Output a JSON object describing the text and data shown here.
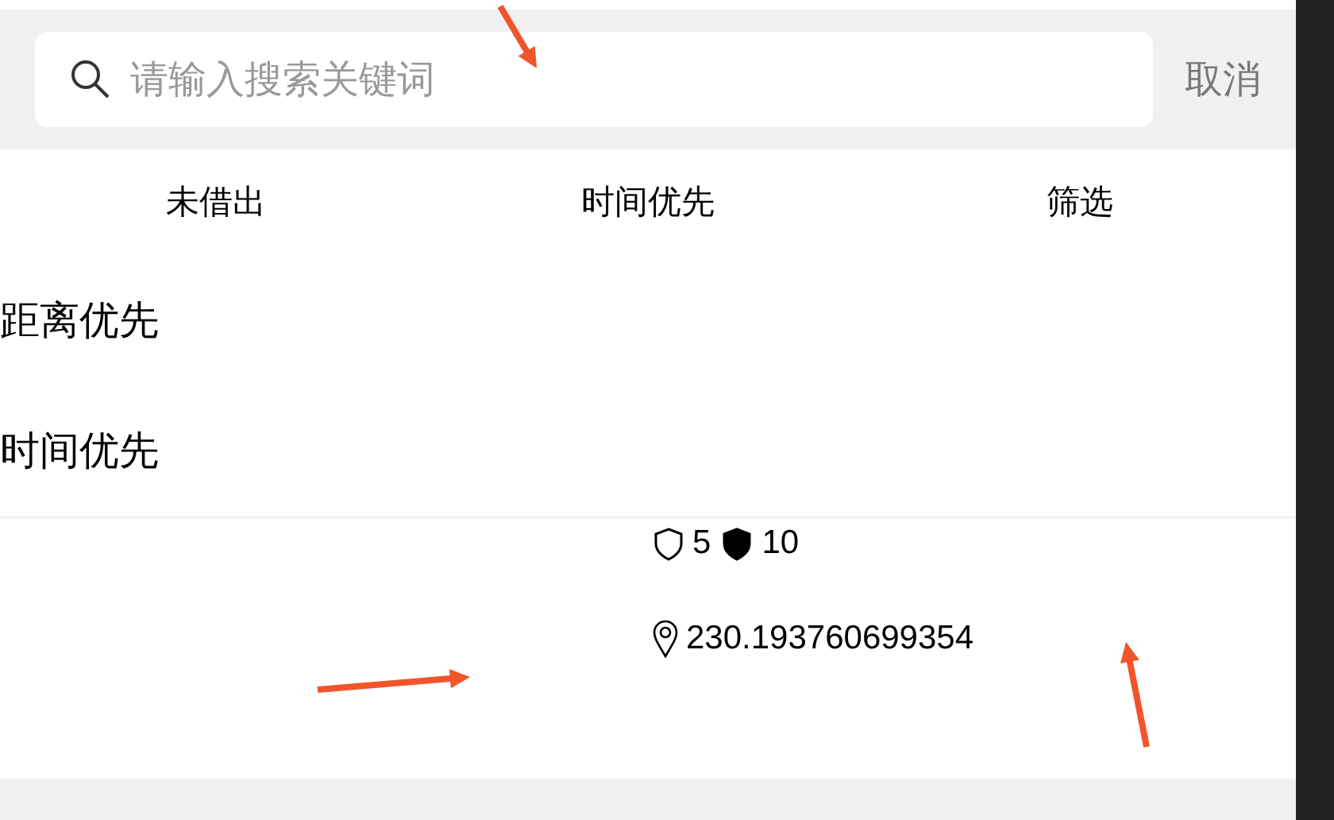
{
  "search": {
    "placeholder": "请输入搜索关键词",
    "cancel": "取消"
  },
  "tabs": [
    {
      "label": "未借出"
    },
    {
      "label": "时间优先"
    },
    {
      "label": "筛选"
    }
  ],
  "sort_menu": {
    "options": [
      {
        "label": "距离优先"
      },
      {
        "label": "时间优先"
      }
    ]
  },
  "item": {
    "deposit": "5",
    "rent": "10",
    "distance": "230.193760699354"
  }
}
